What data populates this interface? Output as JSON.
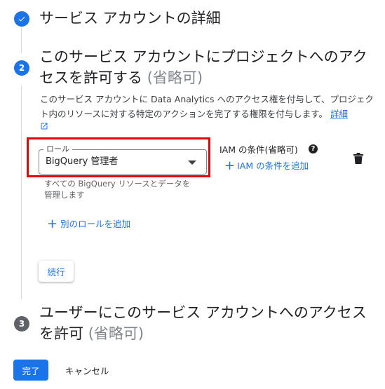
{
  "step1": {
    "title": "サービス アカウントの詳細"
  },
  "step2": {
    "number": "2",
    "title": "このサービス アカウントにプロジェクトへのアクセスを許可する",
    "optional": "(省略可)",
    "description": "このサービス アカウントに Data Analytics へのアクセス権を付与して、プロジェクト内のリソースに対する特定のアクションを完了する権限を付与します。",
    "details_link": "詳細",
    "role": {
      "label": "ロール",
      "value": "BigQuery 管理者",
      "hint": "すべての BigQuery リソースとデータを管理します"
    },
    "iam_condition": {
      "label": "IAM の条件(省略可)",
      "add_label": "IAM の条件を追加"
    },
    "add_role_label": "別のロールを追加",
    "continue_label": "続行",
    "highlight_color": "#e8000b"
  },
  "step3": {
    "number": "3",
    "title": "ユーザーにこのサービス アカウントへのアクセスを許可",
    "optional": "(省略可)"
  },
  "footer": {
    "done_label": "完了",
    "cancel_label": "キャンセル"
  },
  "icons": {
    "step1": "check-circle-icon",
    "help": "help-icon",
    "delete": "trash-icon",
    "external": "external-link-icon"
  },
  "colors": {
    "accent": "#1a73e8",
    "text": "#202124",
    "muted": "#5f6368"
  }
}
